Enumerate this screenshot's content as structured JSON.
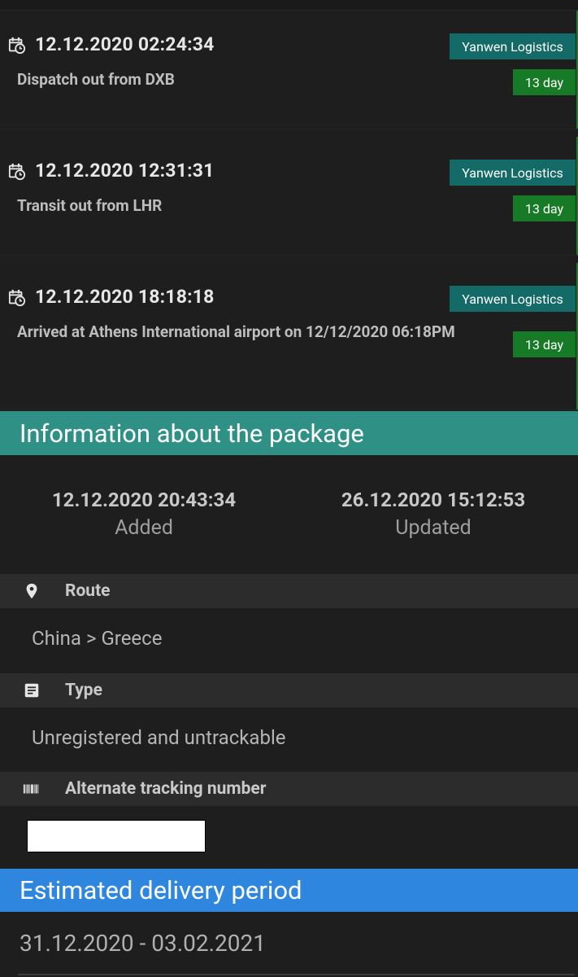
{
  "events": [
    {
      "date": "12.12.2020 02:24:34",
      "desc": "Dispatch out from DXB",
      "carrier": "Yanwen Logistics",
      "days": "13 day"
    },
    {
      "date": "12.12.2020 12:31:31",
      "desc": "Transit out from LHR",
      "carrier": "Yanwen Logistics",
      "days": "13 day"
    },
    {
      "date": "12.12.2020 18:18:18",
      "desc": "Arrived at Athens International airport on 12/12/2020 06:18PM",
      "carrier": "Yanwen Logistics",
      "days": "13 day"
    }
  ],
  "package_info": {
    "title": "Information about the package",
    "added_date": "12.12.2020 20:43:34",
    "added_label": "Added",
    "updated_date": "26.12.2020 15:12:53",
    "updated_label": "Updated"
  },
  "route": {
    "label": "Route",
    "value": "China > Greece",
    "icon": "location-pin-icon"
  },
  "type": {
    "label": "Type",
    "value": "Unregistered and untrackable",
    "icon": "document-icon"
  },
  "alternate": {
    "label": "Alternate tracking number",
    "icon": "barcode-icon"
  },
  "delivery": {
    "title": "Estimated delivery period",
    "period": "31.12.2020 - 03.02.2021"
  },
  "colors": {
    "teal": "#2f9086",
    "carrier_badge": "#136a67",
    "days_badge": "#177a26",
    "blue": "#2e86de",
    "background": "#1e1e1e"
  }
}
